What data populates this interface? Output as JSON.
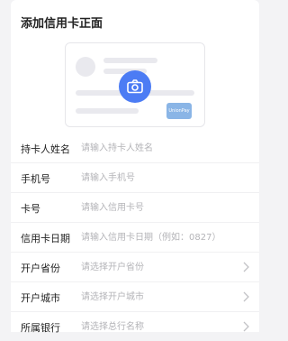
{
  "page": {
    "title": "添加信用卡正面"
  },
  "illustration": {
    "bank_logo_text": "UnionPay 银联"
  },
  "form": {
    "rows": [
      {
        "label": "持卡人姓名",
        "placeholder": "请输入持卡人姓名"
      },
      {
        "label": "手机号",
        "placeholder": "请输入手机号"
      },
      {
        "label": "卡号",
        "placeholder": "请输入信用卡号"
      },
      {
        "label": "信用卡日期",
        "placeholder": "请输入信用卡日期（例如：0827）"
      },
      {
        "label": "开户省份",
        "placeholder": "请选择开户省份",
        "icon": "chevron-right-icon"
      },
      {
        "label": "开户城市",
        "placeholder": "请选择开户城市",
        "icon": "chevron-right-icon"
      },
      {
        "label": "所属银行",
        "placeholder": "请选择总行名称",
        "icon": "chevron-right-icon"
      }
    ]
  },
  "colors": {
    "accent": "#4c7cf4",
    "background": "#f3f3f5"
  }
}
